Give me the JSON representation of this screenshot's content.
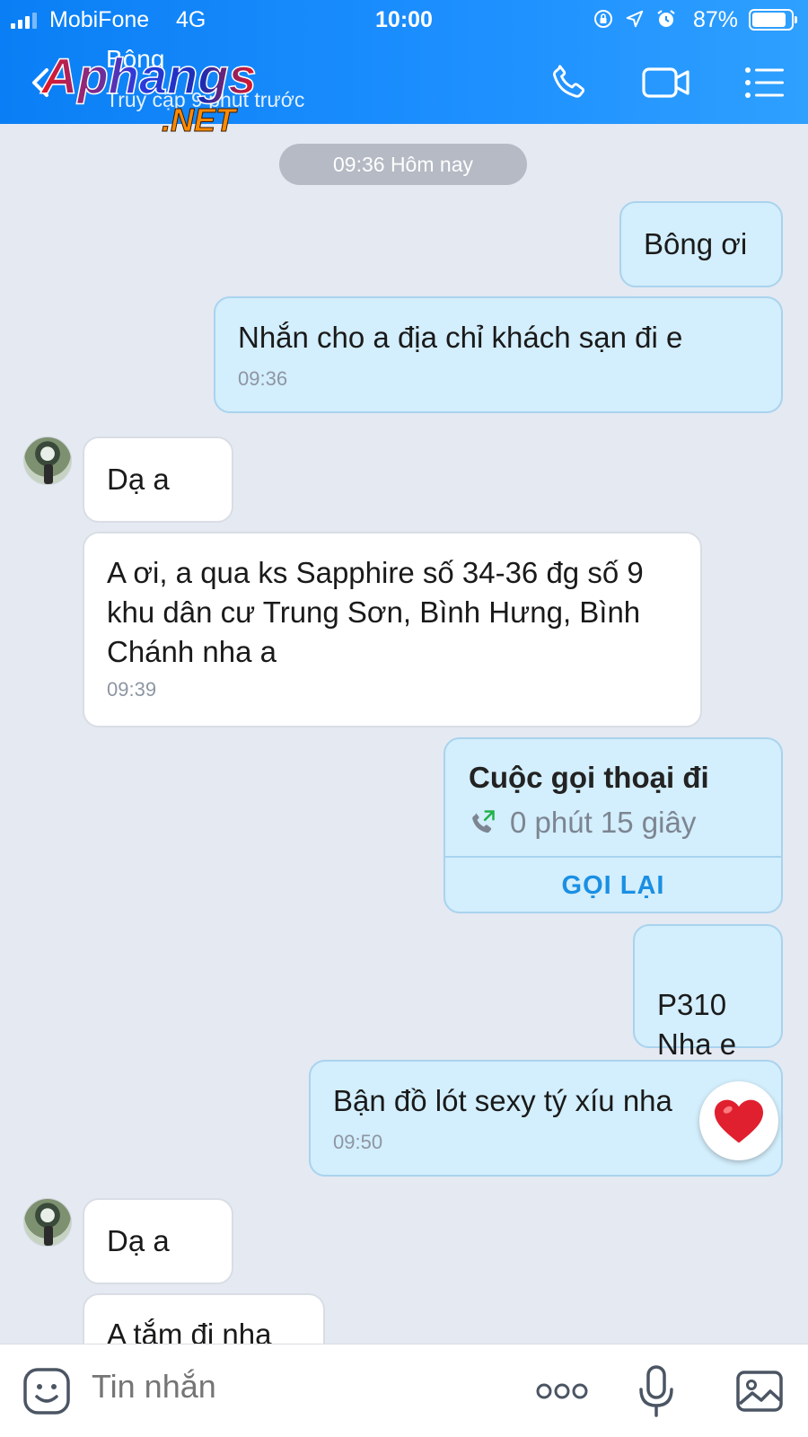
{
  "status_bar": {
    "carrier": "MobiFone",
    "network": "4G",
    "time": "10:00",
    "battery_percent": "87%"
  },
  "header": {
    "contact_name": "Bông",
    "contact_status": "Truy cập 9 phút trước",
    "watermark_main": "Aphangs",
    "watermark_sub": ".NET",
    "icons": [
      "back-icon",
      "phone-icon",
      "video-icon",
      "menu-icon"
    ]
  },
  "chat": {
    "date_separator": "09:36 Hôm nay",
    "messages": [
      {
        "side": "out",
        "text": "Bông ơi",
        "time": ""
      },
      {
        "side": "out",
        "text": "Nhắn cho a địa chỉ khách sạn đi e",
        "time": "09:36"
      },
      {
        "side": "in",
        "text": "Dạ a",
        "time": ""
      },
      {
        "side": "in",
        "text": "A ơi, a qua ks Sapphire số 34-36 đg số 9 khu dân cư Trung Sơn, Bình Hưng, Bình Chánh  nha a",
        "time": "09:39"
      },
      {
        "side": "out",
        "text": "P310\nNha e",
        "time": ""
      },
      {
        "side": "out",
        "text": "Bận đồ lót sexy tý xíu nha",
        "time": "09:50",
        "reaction": "heart"
      },
      {
        "side": "in",
        "text": "Dạ a",
        "time": ""
      },
      {
        "side": "in",
        "text": "A tắm đi nha",
        "time": ""
      }
    ],
    "call_card": {
      "title": "Cuộc gọi thoại đi",
      "duration": "0 phút 15 giây",
      "action": "GỌI LẠI"
    }
  },
  "input_bar": {
    "placeholder": "Tin nhắn"
  },
  "colors": {
    "header": "#1e90ff",
    "chat_background": "#e4e9f2",
    "outgoing_bubble": "#d3eefc",
    "incoming_bubble": "#ffffff",
    "accent": "#1a8fe3",
    "reaction_heart": "#e0202e"
  }
}
